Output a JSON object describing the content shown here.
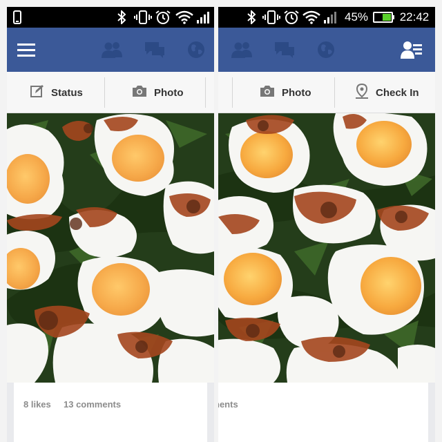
{
  "left_panel": {
    "action_bar": {
      "status_label": "Status",
      "photo_label": "Photo"
    },
    "post": {
      "likes_text": "8 likes",
      "comments_text": "13 comments"
    }
  },
  "right_panel": {
    "status_bar": {
      "battery_percent": "45%",
      "time": "22:42"
    },
    "action_bar": {
      "photo_label": "Photo",
      "check_in_label": "Check In"
    },
    "post": {
      "comments_text_partial": "nents"
    }
  },
  "colors": {
    "facebook_blue": "#3b5998",
    "status_bar_bg": "#000000",
    "battery_green": "#5bd12c",
    "icon_blue_muted": "#2c4a85"
  },
  "icons": {
    "status_bar": [
      "phone-icon",
      "bluetooth-icon",
      "vibrate-icon",
      "alarm-icon",
      "wifi-icon",
      "signal-icon",
      "battery-icon"
    ],
    "fb_bar_left": [
      "menu-icon",
      "friends-icon",
      "messages-icon",
      "globe-icon"
    ],
    "fb_bar_right": [
      "friends-icon",
      "messages-icon",
      "globe-icon",
      "friend-requests-icon"
    ]
  }
}
